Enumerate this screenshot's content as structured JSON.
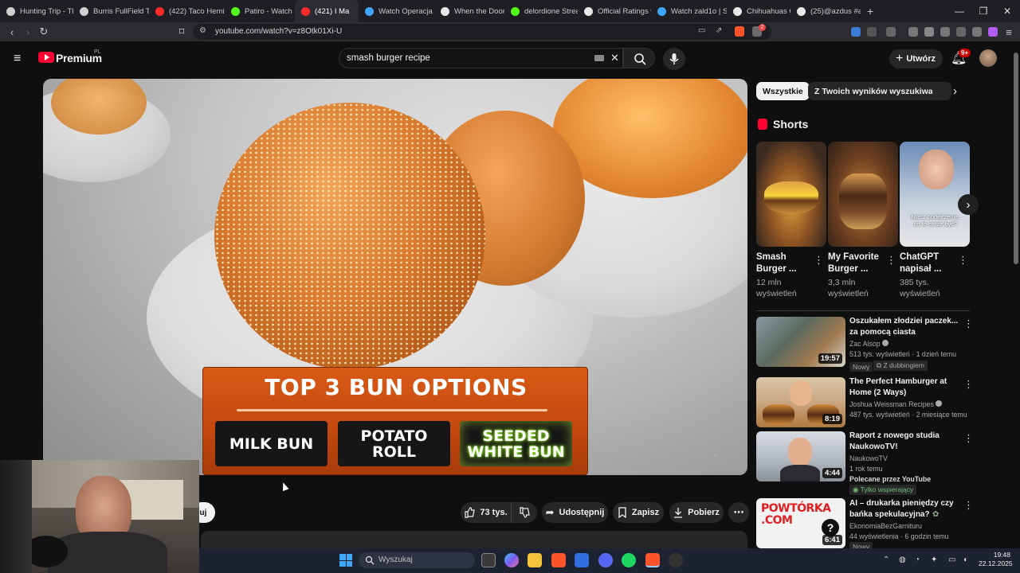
{
  "browser": {
    "tabs": [
      {
        "label": "Hunting Trip - Th",
        "fav_color": "#cfcfcf"
      },
      {
        "label": "Burris FullField TA",
        "fav_color": "#cfcfcf"
      },
      {
        "label": "(422) Taco Hemin",
        "fav_color": "#ff2a2a"
      },
      {
        "label": "Patiro - Watch cli",
        "fav_color": "#53fc18"
      },
      {
        "label": "(421) I Ma",
        "fav_color": "#ff2a2a",
        "active": true
      },
      {
        "label": "Watch Operacja D",
        "fav_color": "#3ea6ff"
      },
      {
        "label": "When the Door C",
        "fav_color": "#e8e8e8"
      },
      {
        "label": "delordione Strea",
        "fav_color": "#53fc18"
      },
      {
        "label": "Official Ratings w",
        "fav_color": "#e8e8e8"
      },
      {
        "label": "Watch zald1o | St",
        "fav_color": "#3ea6ff"
      },
      {
        "label": "Chihuahuas Get",
        "fav_color": "#e8e8e8"
      },
      {
        "label": "(25)@azdus #azd",
        "fav_color": "#e8e8e8"
      }
    ],
    "new_tab": "+",
    "url": "youtube.com/watch?v=z8Otk01Xi-U",
    "extension_badge": "2"
  },
  "youtube": {
    "logo_text": "Premium",
    "logo_region": "PL",
    "search_query": "smash burger recipe",
    "create_label": "Utwórz",
    "notification_count": "9+"
  },
  "video": {
    "overlay_title": "TOP 3 BUN OPTIONS",
    "options": [
      "MILK BUN",
      "POTATO\nROLL",
      "SEEDED\nWHITE BUN"
    ]
  },
  "actions": {
    "subscribe_fragment": "uj",
    "likes": "73 tys.",
    "share": "Udostępnij",
    "save": "Zapisz",
    "download": "Pobierz",
    "more": "⋯"
  },
  "sidebar": {
    "chips": [
      "Wszystkie",
      "Z Twoich wyników wyszukiwania"
    ],
    "shorts_heading": "Shorts",
    "shorts": [
      {
        "title": "Smash Burger ...",
        "views": "12 mln wyświetleń"
      },
      {
        "title": "My Favorite Burger ...",
        "views": "3,3 mln wyświetleń"
      },
      {
        "title": "ChatGPT napisał ...",
        "views": "385 tys. wyświetleń",
        "caption": "Masz podejrzenie, co to może być?"
      }
    ],
    "recommendations": [
      {
        "title": "Oszukałem złodziei paczek... za pomocą ciasta",
        "channel": "Zac Alsop",
        "stats": "513 tys. wyświetleń · 1 dzień temu",
        "duration": "19:57",
        "badges": [
          "Nowy",
          "Z dubbingiem"
        ]
      },
      {
        "title": "The Perfect Hamburger at Home (2 Ways)",
        "channel": "Joshua Weissman Recipes",
        "stats": "487 tys. wyświetleń · 2 miesiące temu",
        "duration": "8:19",
        "badges": []
      },
      {
        "title": "Raport z nowego studia NaukowoTV!",
        "channel": "NaukowoTV",
        "stats": "1 rok temu",
        "note": "Polecane przez YouTube",
        "duration": "4:44",
        "badges": [
          "Tylko wspierający"
        ]
      },
      {
        "title": "AI – drukarka pieniędzy czy bańka spekulacyjna?",
        "channel": "EkonomiaBezGarnituru",
        "stats": "44 wyświetlenia · 6 godzin temu",
        "duration": "6:41",
        "badges": [
          "Nowy"
        ],
        "thumb_text": "POWTÓRKA .COM"
      }
    ]
  },
  "taskbar": {
    "search_placeholder": "Wyszukaj",
    "time": "19:48",
    "date": "22.12.2025"
  }
}
